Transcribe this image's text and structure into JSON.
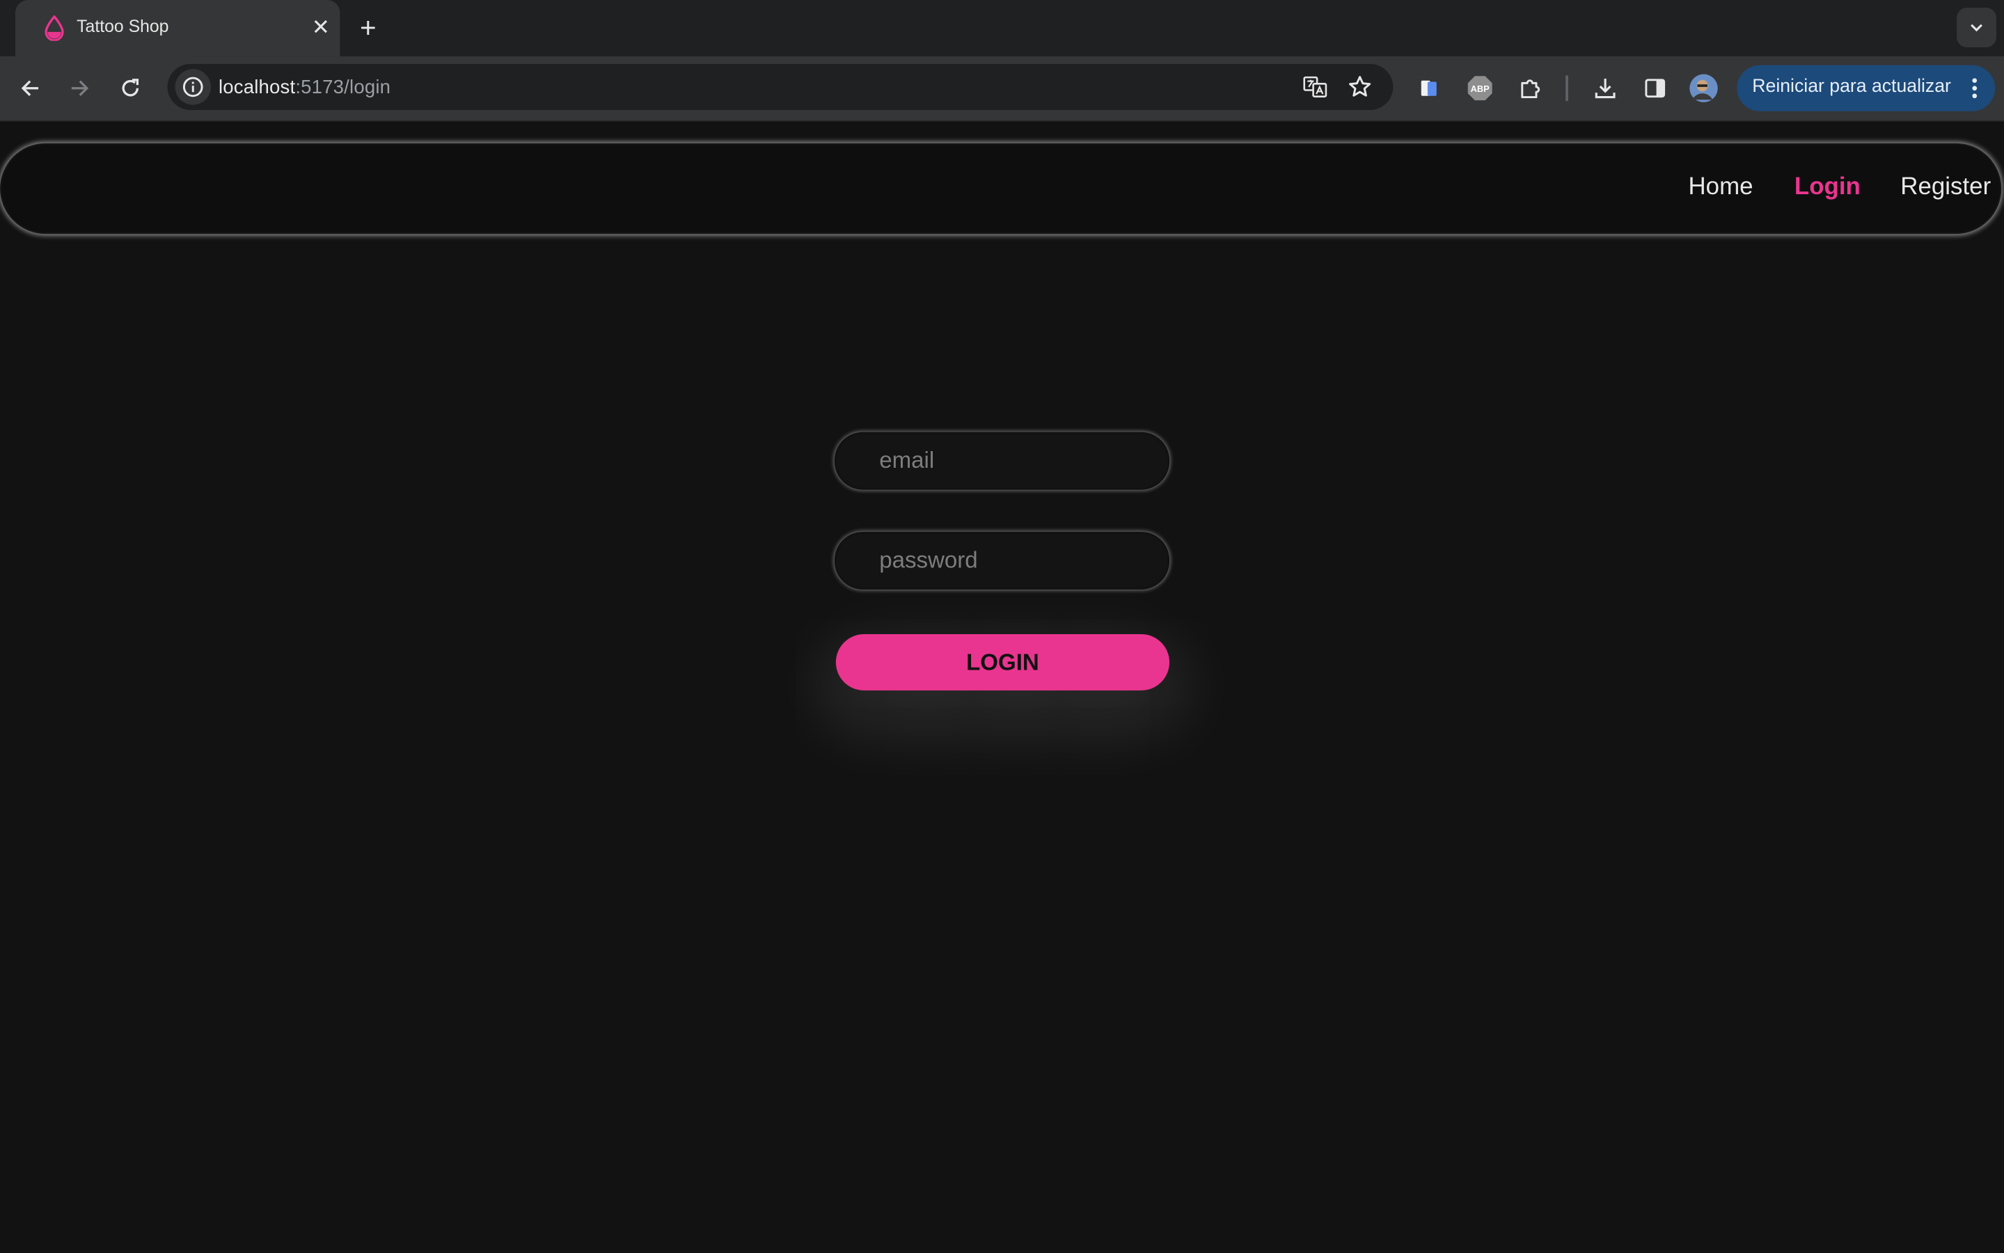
{
  "browser": {
    "tab": {
      "title": "Tattoo Shop",
      "favicon": "ink-drop-icon",
      "close_glyph": "✕"
    },
    "new_tab_glyph": "+",
    "address": {
      "host": "localhost",
      "path": ":5173/login"
    },
    "update_button_label": "Reiniciar para actualizar"
  },
  "page": {
    "nav": {
      "links": [
        {
          "label": "Home",
          "active": false
        },
        {
          "label": "Login",
          "active": true
        },
        {
          "label": "Register",
          "active": false
        }
      ]
    },
    "form": {
      "email_placeholder": "email",
      "email_value": "",
      "password_placeholder": "password",
      "password_value": "",
      "submit_label": "LOGIN"
    }
  },
  "colors": {
    "accent": "#e9358f",
    "page_bg": "#121212",
    "navbar_bg": "#0e0e0e",
    "chrome_toolbar": "#353637",
    "chrome_tabstrip": "#1f2021",
    "update_button": "#1c4a7a"
  }
}
